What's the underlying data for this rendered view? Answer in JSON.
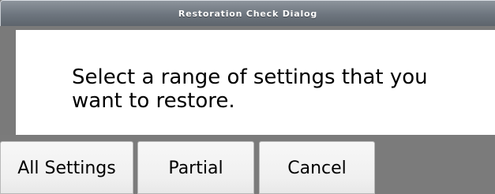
{
  "dialog": {
    "title": "Restoration Check Dialog",
    "message": "Select a range of settings that you want to restore.",
    "buttons": {
      "all_settings": "All Settings",
      "partial": "Partial",
      "cancel": "Cancel"
    }
  }
}
